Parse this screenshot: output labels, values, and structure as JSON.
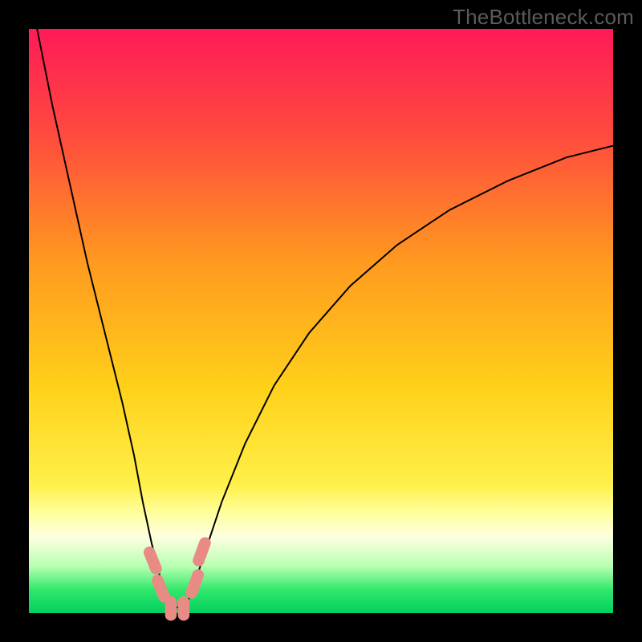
{
  "watermark": {
    "text": "TheBottleneck.com"
  },
  "chart_data": {
    "type": "line",
    "title": "",
    "xlabel": "",
    "ylabel": "",
    "xlim": [
      0,
      100
    ],
    "ylim": [
      0,
      100
    ],
    "grid": false,
    "legend": false,
    "background_gradient_stops": [
      {
        "pct": 0,
        "color": "#ff1a58"
      },
      {
        "pct": 18,
        "color": "#ff4a3e"
      },
      {
        "pct": 40,
        "color": "#ff9a1f"
      },
      {
        "pct": 62,
        "color": "#ffd21a"
      },
      {
        "pct": 78,
        "color": "#fff04a"
      },
      {
        "pct": 83,
        "color": "#ffffa0"
      },
      {
        "pct": 87,
        "color": "#fdffe0"
      },
      {
        "pct": 92,
        "color": "#b7ffb0"
      },
      {
        "pct": 96,
        "color": "#32e86b"
      },
      {
        "pct": 100,
        "color": "#00d060"
      }
    ],
    "series": [
      {
        "name": "bottleneck-curve",
        "color": "#000000",
        "x": [
          0,
          2,
          4,
          6,
          8,
          10,
          12,
          14,
          16,
          18,
          19.5,
          21,
          22.5,
          24,
          25,
          26,
          27,
          28,
          30,
          33,
          37,
          42,
          48,
          55,
          63,
          72,
          82,
          92,
          100
        ],
        "y": [
          107,
          97,
          87,
          78,
          69,
          60,
          52,
          44,
          36,
          27,
          19,
          12,
          6,
          2.5,
          1.0,
          1.0,
          1.5,
          4,
          10,
          19,
          29,
          39,
          48,
          56,
          63,
          69,
          74,
          78,
          80
        ]
      }
    ],
    "markers": [
      {
        "name": "optimal-marker",
        "x": 21.2,
        "y": 9.0,
        "color": "#e98b85",
        "w": 2.0,
        "h": 5.0,
        "angle": -22
      },
      {
        "name": "optimal-marker",
        "x": 22.6,
        "y": 4.2,
        "color": "#e98b85",
        "w": 2.0,
        "h": 5.0,
        "angle": -22
      },
      {
        "name": "optimal-marker",
        "x": 24.3,
        "y": 0.8,
        "color": "#e98b85",
        "w": 2.0,
        "h": 4.2,
        "angle": 0
      },
      {
        "name": "optimal-marker",
        "x": 26.5,
        "y": 0.8,
        "color": "#e98b85",
        "w": 2.0,
        "h": 4.2,
        "angle": 0
      },
      {
        "name": "optimal-marker",
        "x": 28.4,
        "y": 5.0,
        "color": "#e98b85",
        "w": 2.0,
        "h": 5.2,
        "angle": 20
      },
      {
        "name": "optimal-marker",
        "x": 29.6,
        "y": 10.5,
        "color": "#e98b85",
        "w": 2.0,
        "h": 5.2,
        "angle": 20
      }
    ]
  }
}
